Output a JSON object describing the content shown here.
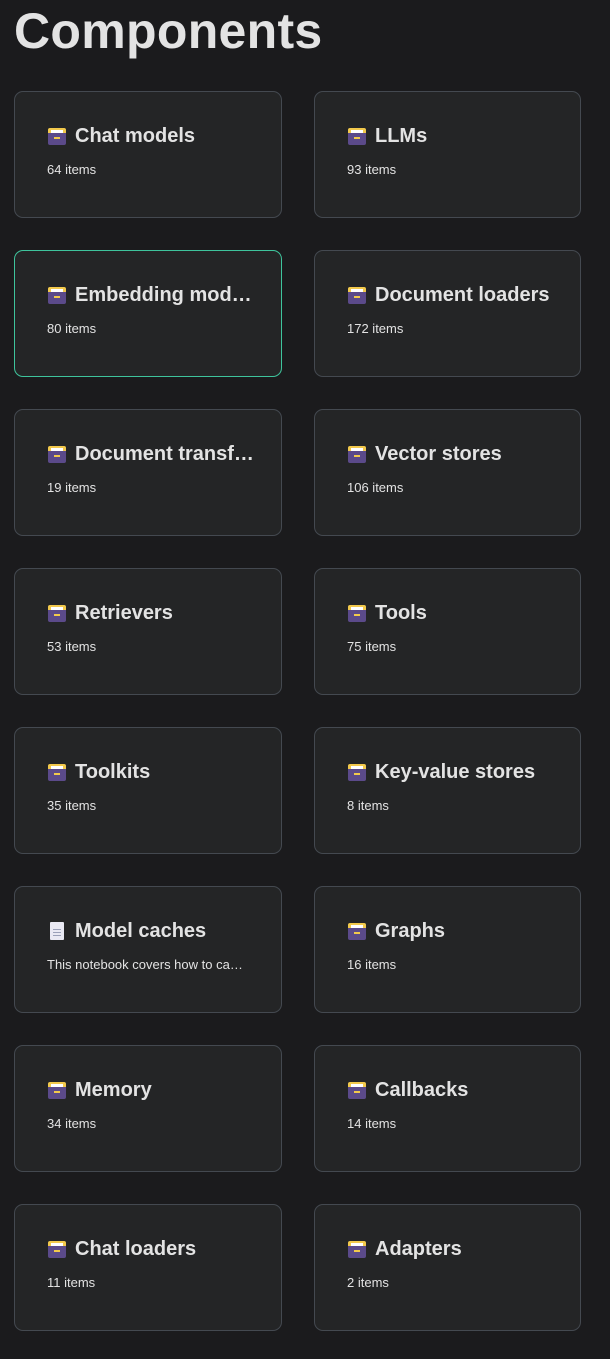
{
  "page": {
    "title": "Components"
  },
  "colors": {
    "background": "#1b1b1d",
    "card_background": "#242526",
    "card_border": "#444950",
    "active_border": "#3ec49c",
    "text": "#e3e3e3"
  },
  "cards": [
    {
      "title": "Chat models",
      "subtitle": "64 items",
      "icon": "file-cabinet-icon"
    },
    {
      "title": "LLMs",
      "subtitle": "93 items",
      "icon": "file-cabinet-icon"
    },
    {
      "title": "Embedding mod…",
      "subtitle": "80 items",
      "icon": "file-cabinet-icon",
      "active": true
    },
    {
      "title": "Document loaders",
      "subtitle": "172 items",
      "icon": "file-cabinet-icon"
    },
    {
      "title": "Document transf…",
      "subtitle": "19 items",
      "icon": "file-cabinet-icon"
    },
    {
      "title": "Vector stores",
      "subtitle": "106 items",
      "icon": "file-cabinet-icon"
    },
    {
      "title": "Retrievers",
      "subtitle": "53 items",
      "icon": "file-cabinet-icon"
    },
    {
      "title": "Tools",
      "subtitle": "75 items",
      "icon": "file-cabinet-icon"
    },
    {
      "title": "Toolkits",
      "subtitle": "35 items",
      "icon": "file-cabinet-icon"
    },
    {
      "title": "Key-value stores",
      "subtitle": "8 items",
      "icon": "file-cabinet-icon"
    },
    {
      "title": "Model caches",
      "subtitle": "This notebook covers how to ca…",
      "icon": "page-icon"
    },
    {
      "title": "Graphs",
      "subtitle": "16 items",
      "icon": "file-cabinet-icon"
    },
    {
      "title": "Memory",
      "subtitle": "34 items",
      "icon": "file-cabinet-icon"
    },
    {
      "title": "Callbacks",
      "subtitle": "14 items",
      "icon": "file-cabinet-icon"
    },
    {
      "title": "Chat loaders",
      "subtitle": "11 items",
      "icon": "file-cabinet-icon"
    },
    {
      "title": "Adapters",
      "subtitle": "2 items",
      "icon": "file-cabinet-icon"
    }
  ]
}
